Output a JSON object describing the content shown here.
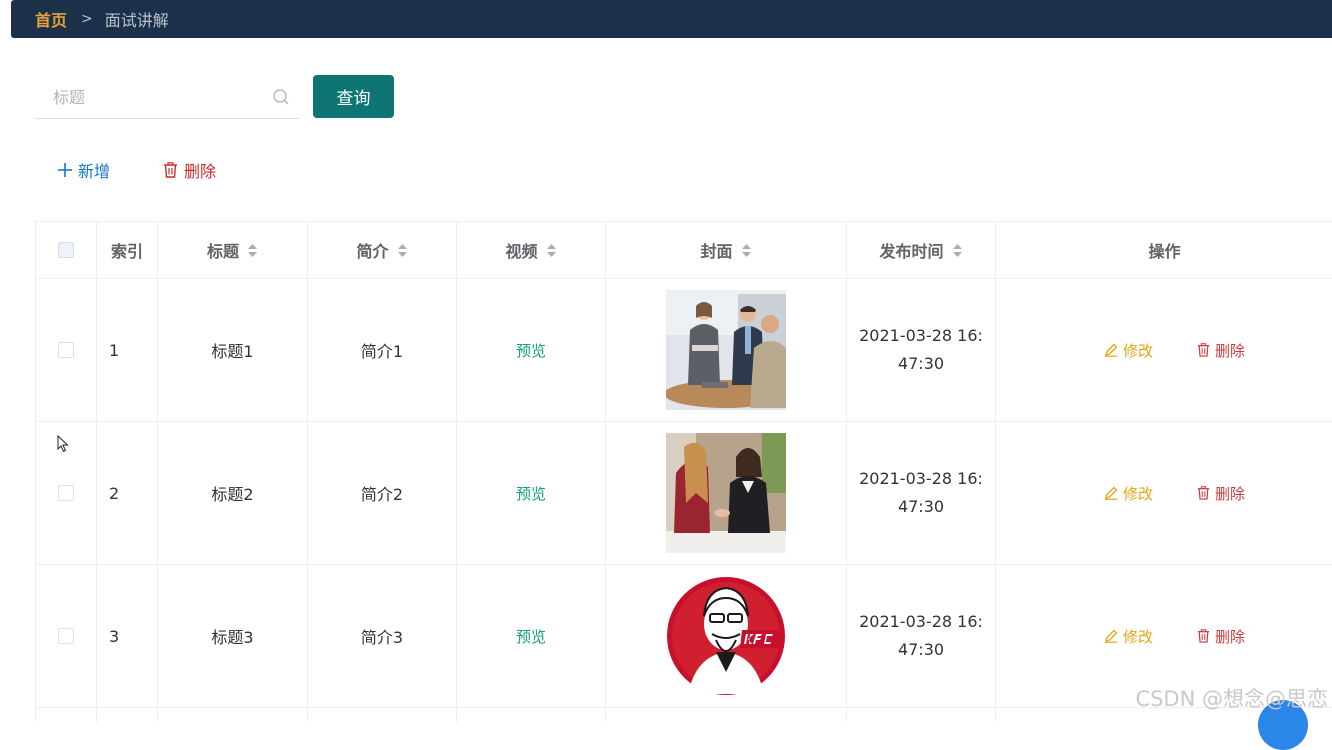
{
  "breadcrumb": {
    "home": "首页",
    "separator": ">",
    "current": "面试讲解"
  },
  "search": {
    "placeholder": "标题",
    "value": "",
    "button_label": "查询"
  },
  "toolbar": {
    "add_label": "新增",
    "delete_label": "删除"
  },
  "table": {
    "headers": {
      "index": "索引",
      "title": "标题",
      "intro": "简介",
      "video": "视频",
      "cover": "封面",
      "publish_time": "发布时间",
      "actions": "操作"
    },
    "rows": [
      {
        "index": "1",
        "title": "标题1",
        "intro": "简介1",
        "video": "预览",
        "cover": "business-meeting-photo",
        "time_line1": "2021-03-28 16:",
        "time_line2": "47:30",
        "edit": "修改",
        "delete": "删除"
      },
      {
        "index": "2",
        "title": "标题2",
        "intro": "简介2",
        "video": "预览",
        "cover": "handshake-interview-photo",
        "time_line1": "2021-03-28 16:",
        "time_line2": "47:30",
        "edit": "修改",
        "delete": "删除"
      },
      {
        "index": "3",
        "title": "标题3",
        "intro": "简介3",
        "video": "预览",
        "cover": "kfc-logo",
        "time_line1": "2021-03-28 16:",
        "time_line2": "47:30",
        "edit": "修改",
        "delete": "删除"
      }
    ]
  },
  "watermark": "CSDN @想念@思恋",
  "colors": {
    "topbar": "#1c3049",
    "breadcrumb_home": "#e8a23a",
    "primary_button": "#0e7573",
    "add": "#1177cc",
    "delete": "#cc2a2a",
    "preview": "#15a07d",
    "edit": "#e3a612"
  }
}
